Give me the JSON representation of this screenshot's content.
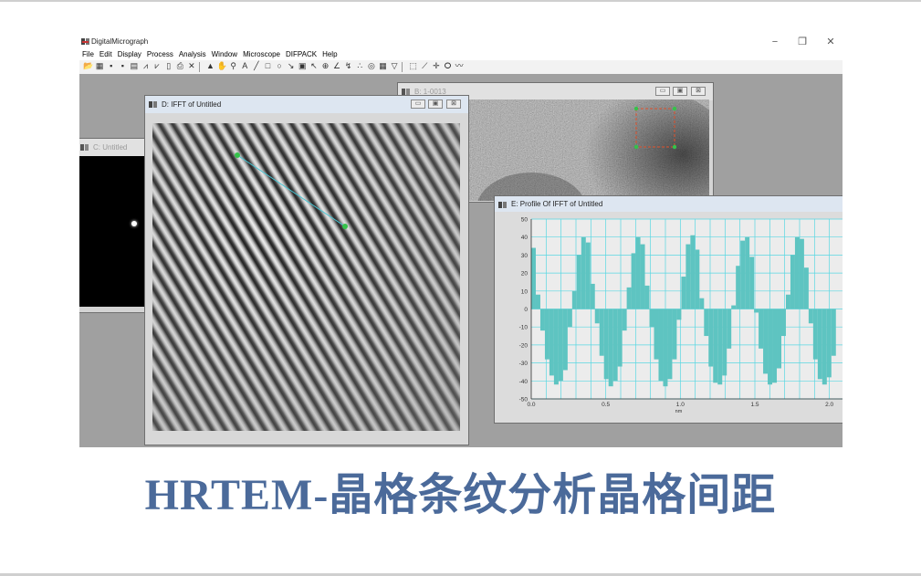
{
  "app": {
    "title": "DigitalMicrograph",
    "controls": {
      "minimize": "−",
      "restore": "❐",
      "close": "✕"
    }
  },
  "menu": [
    "File",
    "Edit",
    "Display",
    "Process",
    "Analysis",
    "Window",
    "Microscope",
    "DIFPACK",
    "Help"
  ],
  "toolbar": {
    "buttons": [
      {
        "icon": "open-icon",
        "glyph": "📂"
      },
      {
        "icon": "image-icon",
        "glyph": "▦"
      },
      {
        "icon": "save-icon",
        "glyph": "▪"
      },
      {
        "icon": "save-all-icon",
        "glyph": "▪"
      },
      {
        "icon": "print-icon",
        "glyph": "▤"
      },
      {
        "icon": "line-plot-icon",
        "glyph": "⩘"
      },
      {
        "icon": "histogram-icon",
        "glyph": "⩗"
      },
      {
        "icon": "page-icon",
        "glyph": "▯"
      },
      {
        "icon": "printer-icon",
        "glyph": "⎙"
      },
      {
        "icon": "tools-icon",
        "glyph": "✕"
      },
      {
        "icon": "pointer-icon",
        "glyph": "▲"
      },
      {
        "icon": "hand-icon",
        "glyph": "✋"
      },
      {
        "icon": "zoom-icon",
        "glyph": "⚲"
      },
      {
        "icon": "text-icon",
        "glyph": "A"
      },
      {
        "icon": "line-icon",
        "glyph": "╱"
      },
      {
        "icon": "rectangle-icon",
        "glyph": "□"
      },
      {
        "icon": "oval-icon",
        "glyph": "○"
      },
      {
        "icon": "arrow-icon",
        "glyph": "↘"
      },
      {
        "icon": "roi-icon",
        "glyph": "▣"
      },
      {
        "icon": "magic-icon",
        "glyph": "↖"
      },
      {
        "icon": "crosshair-icon",
        "glyph": "⊕"
      },
      {
        "icon": "angle-icon",
        "glyph": "∠"
      },
      {
        "icon": "measure-icon",
        "glyph": "↯"
      },
      {
        "icon": "points-icon",
        "glyph": "∴"
      },
      {
        "icon": "target-icon",
        "glyph": "◎"
      },
      {
        "icon": "grid-icon",
        "glyph": "▦"
      },
      {
        "icon": "funnel-icon",
        "glyph": "▽"
      },
      {
        "icon": "rect-roi-icon",
        "glyph": "⬚"
      },
      {
        "icon": "line-roi-icon",
        "glyph": "⟋"
      },
      {
        "icon": "point-roi-icon",
        "glyph": "✛"
      },
      {
        "icon": "lasso-icon",
        "glyph": "ⵔ"
      },
      {
        "icon": "curve-icon",
        "glyph": "〰"
      }
    ]
  },
  "windows": {
    "untitled": {
      "title": "C: Untitled"
    },
    "ifft": {
      "title": "D: IFFT of Untitled"
    },
    "image": {
      "title": "B: 1-0013"
    },
    "profile": {
      "title": "E: Profile Of IFFT of Untitled"
    }
  },
  "window_buttons": {
    "minimize": "▭",
    "maximize": "▣",
    "close": "⊠"
  },
  "chart_data": {
    "type": "bar",
    "title": "E: Profile Of IFFT of Untitled",
    "xlabel": "nm",
    "ylabel": "",
    "xlim": [
      0.0,
      2.1
    ],
    "ylim": [
      -50,
      50
    ],
    "x_ticks": [
      "0.0",
      "0.5",
      "1.0",
      "1.5",
      "2.0"
    ],
    "y_ticks": [
      "50",
      "40",
      "30",
      "20",
      "10",
      "0",
      "-10",
      "-20",
      "-30",
      "-40",
      "-50"
    ],
    "grid": true,
    "bar_color": "#5ec4c1",
    "period_nm": 0.231,
    "amplitude": 42,
    "bar_width_nm": 0.0305,
    "values": [
      34,
      8,
      -12,
      -28,
      -37,
      -42,
      -40,
      -34,
      -10,
      10,
      30,
      40,
      37,
      14,
      -8,
      -26,
      -39,
      -43,
      -40,
      -32,
      -12,
      12,
      31,
      40,
      36,
      13,
      -10,
      -28,
      -40,
      -43,
      -39,
      -28,
      -6,
      18,
      36,
      41,
      33,
      6,
      -15,
      -32,
      -41,
      -42,
      -37,
      -22,
      2,
      24,
      38,
      40,
      29,
      -2,
      -22,
      -36,
      -42,
      -41,
      -33,
      -15,
      8,
      30,
      40,
      39,
      23,
      -8,
      -28,
      -39,
      -42,
      -38,
      -26
    ]
  },
  "caption": "HRTEM-晶格条纹分析晶格间距",
  "colors": {
    "workspace": "#a0a0a0",
    "chart_bg": "#ececec",
    "grid": "#58d7e2",
    "caption": "#4b6a9a",
    "marker": "#35c24a"
  }
}
